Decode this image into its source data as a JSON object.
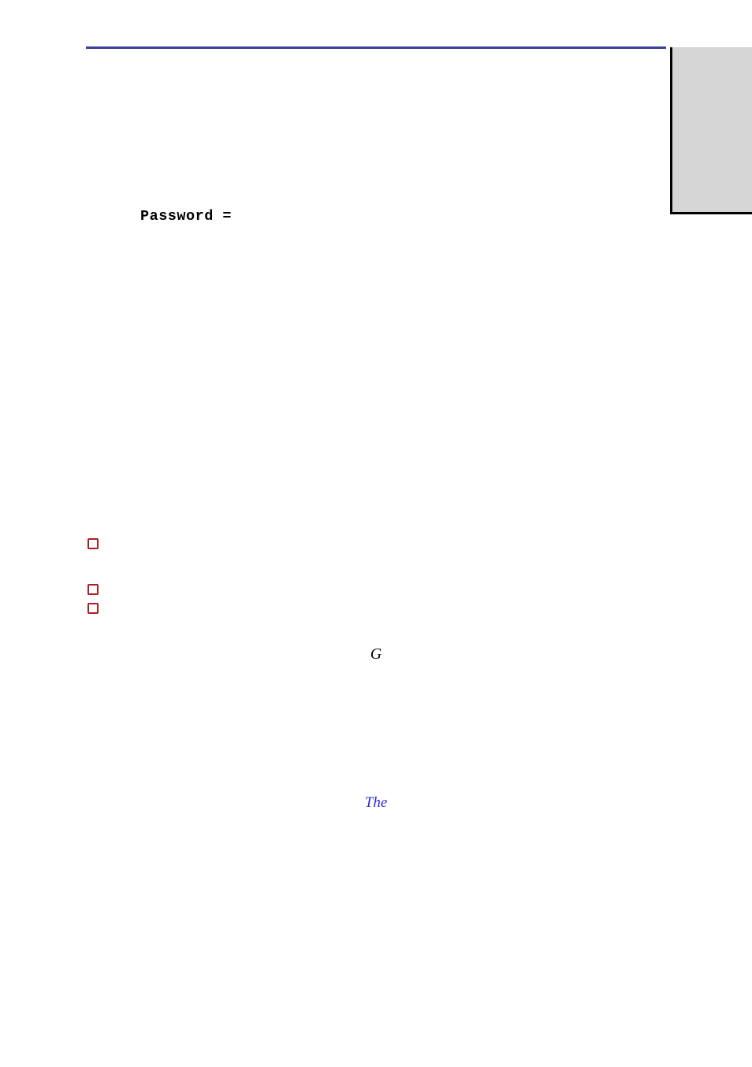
{
  "pwd_label": "Password =",
  "g_text": "G",
  "the_text": "The"
}
